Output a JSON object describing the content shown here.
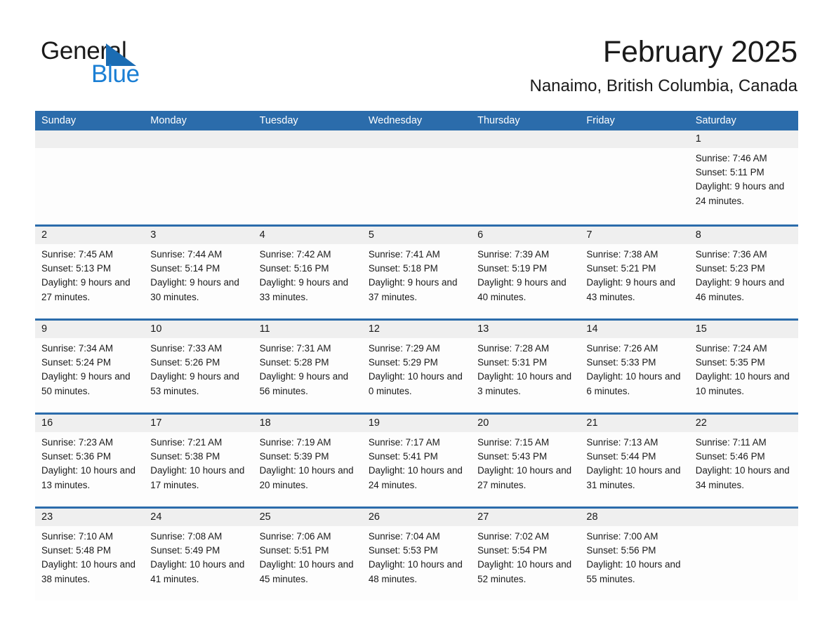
{
  "brand": {
    "name_part1": "General",
    "name_part2": "Blue",
    "triangle_color": "#1b6cb3",
    "blue_color": "#1b7fd4"
  },
  "header": {
    "month_title": "February 2025",
    "location": "Nanaimo, British Columbia, Canada"
  },
  "theme": {
    "header_blue": "#2b6cab",
    "day_band_gray": "#efefef",
    "cell_white": "#fdfdfd"
  },
  "calendar": {
    "weekdays": [
      "Sunday",
      "Monday",
      "Tuesday",
      "Wednesday",
      "Thursday",
      "Friday",
      "Saturday"
    ],
    "weeks": [
      [
        {
          "day": "",
          "empty": true
        },
        {
          "day": "",
          "empty": true
        },
        {
          "day": "",
          "empty": true
        },
        {
          "day": "",
          "empty": true
        },
        {
          "day": "",
          "empty": true
        },
        {
          "day": "",
          "empty": true
        },
        {
          "day": "1",
          "sunrise": "Sunrise: 7:46 AM",
          "sunset": "Sunset: 5:11 PM",
          "daylight": "Daylight: 9 hours and 24 minutes."
        }
      ],
      [
        {
          "day": "2",
          "sunrise": "Sunrise: 7:45 AM",
          "sunset": "Sunset: 5:13 PM",
          "daylight": "Daylight: 9 hours and 27 minutes."
        },
        {
          "day": "3",
          "sunrise": "Sunrise: 7:44 AM",
          "sunset": "Sunset: 5:14 PM",
          "daylight": "Daylight: 9 hours and 30 minutes."
        },
        {
          "day": "4",
          "sunrise": "Sunrise: 7:42 AM",
          "sunset": "Sunset: 5:16 PM",
          "daylight": "Daylight: 9 hours and 33 minutes."
        },
        {
          "day": "5",
          "sunrise": "Sunrise: 7:41 AM",
          "sunset": "Sunset: 5:18 PM",
          "daylight": "Daylight: 9 hours and 37 minutes."
        },
        {
          "day": "6",
          "sunrise": "Sunrise: 7:39 AM",
          "sunset": "Sunset: 5:19 PM",
          "daylight": "Daylight: 9 hours and 40 minutes."
        },
        {
          "day": "7",
          "sunrise": "Sunrise: 7:38 AM",
          "sunset": "Sunset: 5:21 PM",
          "daylight": "Daylight: 9 hours and 43 minutes."
        },
        {
          "day": "8",
          "sunrise": "Sunrise: 7:36 AM",
          "sunset": "Sunset: 5:23 PM",
          "daylight": "Daylight: 9 hours and 46 minutes."
        }
      ],
      [
        {
          "day": "9",
          "sunrise": "Sunrise: 7:34 AM",
          "sunset": "Sunset: 5:24 PM",
          "daylight": "Daylight: 9 hours and 50 minutes."
        },
        {
          "day": "10",
          "sunrise": "Sunrise: 7:33 AM",
          "sunset": "Sunset: 5:26 PM",
          "daylight": "Daylight: 9 hours and 53 minutes."
        },
        {
          "day": "11",
          "sunrise": "Sunrise: 7:31 AM",
          "sunset": "Sunset: 5:28 PM",
          "daylight": "Daylight: 9 hours and 56 minutes."
        },
        {
          "day": "12",
          "sunrise": "Sunrise: 7:29 AM",
          "sunset": "Sunset: 5:29 PM",
          "daylight": "Daylight: 10 hours and 0 minutes."
        },
        {
          "day": "13",
          "sunrise": "Sunrise: 7:28 AM",
          "sunset": "Sunset: 5:31 PM",
          "daylight": "Daylight: 10 hours and 3 minutes."
        },
        {
          "day": "14",
          "sunrise": "Sunrise: 7:26 AM",
          "sunset": "Sunset: 5:33 PM",
          "daylight": "Daylight: 10 hours and 6 minutes."
        },
        {
          "day": "15",
          "sunrise": "Sunrise: 7:24 AM",
          "sunset": "Sunset: 5:35 PM",
          "daylight": "Daylight: 10 hours and 10 minutes."
        }
      ],
      [
        {
          "day": "16",
          "sunrise": "Sunrise: 7:23 AM",
          "sunset": "Sunset: 5:36 PM",
          "daylight": "Daylight: 10 hours and 13 minutes."
        },
        {
          "day": "17",
          "sunrise": "Sunrise: 7:21 AM",
          "sunset": "Sunset: 5:38 PM",
          "daylight": "Daylight: 10 hours and 17 minutes."
        },
        {
          "day": "18",
          "sunrise": "Sunrise: 7:19 AM",
          "sunset": "Sunset: 5:39 PM",
          "daylight": "Daylight: 10 hours and 20 minutes."
        },
        {
          "day": "19",
          "sunrise": "Sunrise: 7:17 AM",
          "sunset": "Sunset: 5:41 PM",
          "daylight": "Daylight: 10 hours and 24 minutes."
        },
        {
          "day": "20",
          "sunrise": "Sunrise: 7:15 AM",
          "sunset": "Sunset: 5:43 PM",
          "daylight": "Daylight: 10 hours and 27 minutes."
        },
        {
          "day": "21",
          "sunrise": "Sunrise: 7:13 AM",
          "sunset": "Sunset: 5:44 PM",
          "daylight": "Daylight: 10 hours and 31 minutes."
        },
        {
          "day": "22",
          "sunrise": "Sunrise: 7:11 AM",
          "sunset": "Sunset: 5:46 PM",
          "daylight": "Daylight: 10 hours and 34 minutes."
        }
      ],
      [
        {
          "day": "23",
          "sunrise": "Sunrise: 7:10 AM",
          "sunset": "Sunset: 5:48 PM",
          "daylight": "Daylight: 10 hours and 38 minutes."
        },
        {
          "day": "24",
          "sunrise": "Sunrise: 7:08 AM",
          "sunset": "Sunset: 5:49 PM",
          "daylight": "Daylight: 10 hours and 41 minutes."
        },
        {
          "day": "25",
          "sunrise": "Sunrise: 7:06 AM",
          "sunset": "Sunset: 5:51 PM",
          "daylight": "Daylight: 10 hours and 45 minutes."
        },
        {
          "day": "26",
          "sunrise": "Sunrise: 7:04 AM",
          "sunset": "Sunset: 5:53 PM",
          "daylight": "Daylight: 10 hours and 48 minutes."
        },
        {
          "day": "27",
          "sunrise": "Sunrise: 7:02 AM",
          "sunset": "Sunset: 5:54 PM",
          "daylight": "Daylight: 10 hours and 52 minutes."
        },
        {
          "day": "28",
          "sunrise": "Sunrise: 7:00 AM",
          "sunset": "Sunset: 5:56 PM",
          "daylight": "Daylight: 10 hours and 55 minutes."
        },
        {
          "day": "",
          "empty": true
        }
      ]
    ]
  }
}
